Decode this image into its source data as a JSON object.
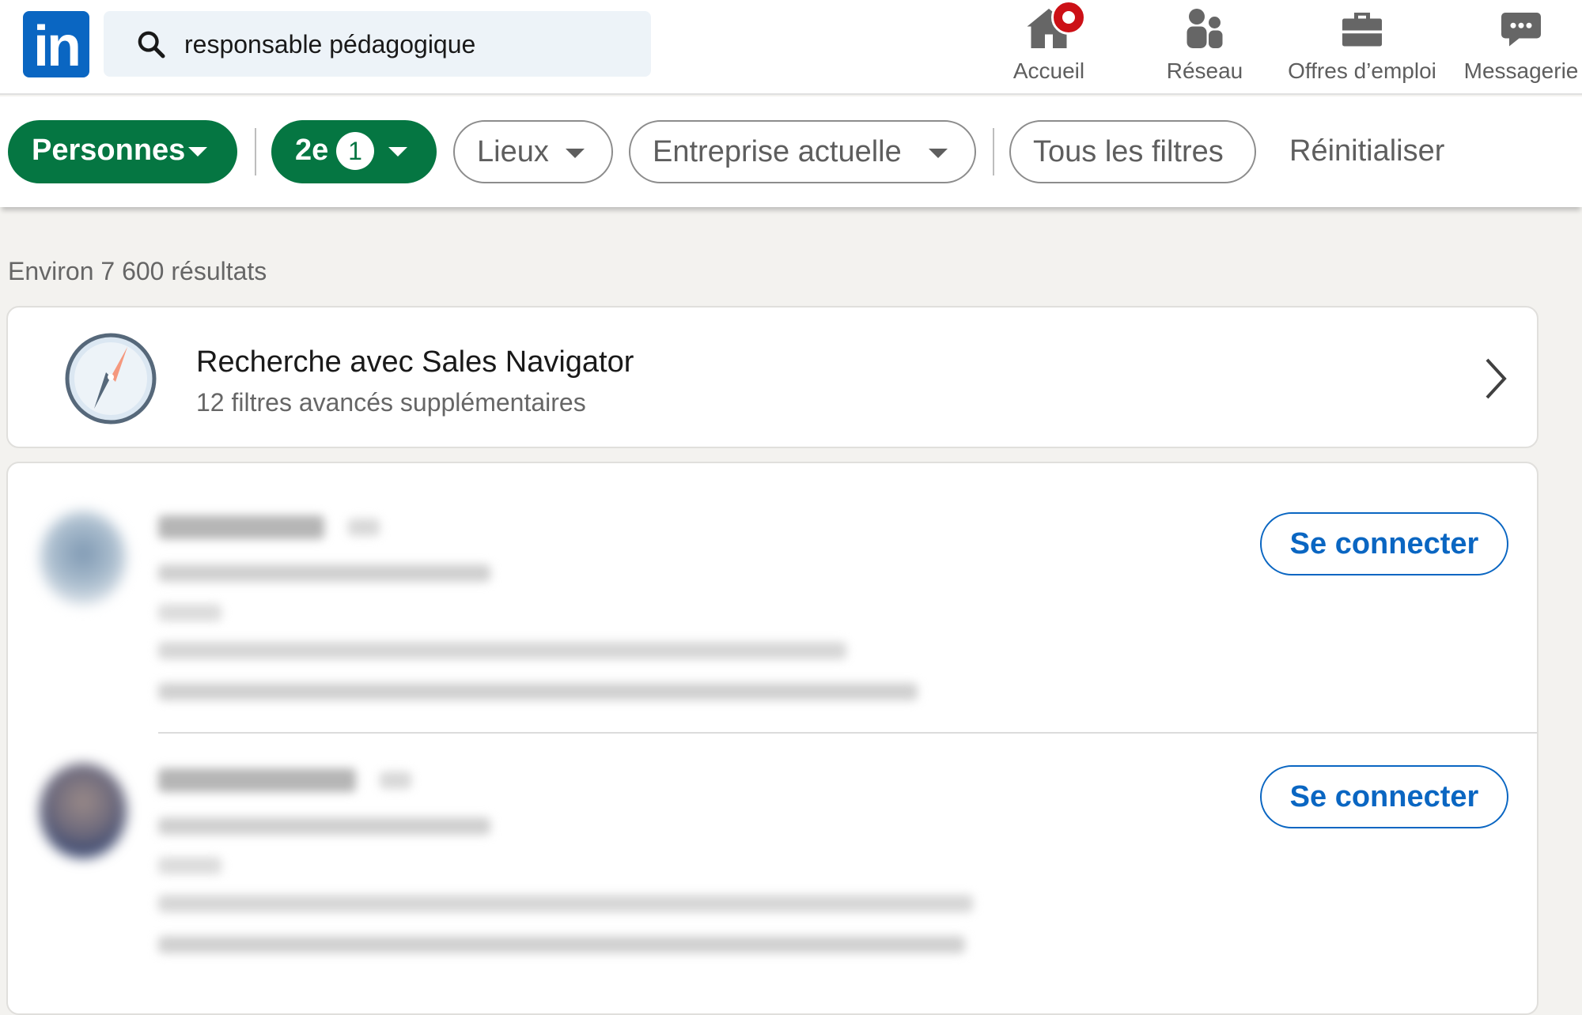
{
  "nav": {
    "logo": "in",
    "search_value": "responsable pédagogique",
    "items": [
      {
        "label": "Accueil",
        "icon": "home-icon"
      },
      {
        "label": "Réseau",
        "icon": "network-icon"
      },
      {
        "label": "Offres d’emploi",
        "icon": "briefcase-icon"
      },
      {
        "label": "Messagerie",
        "icon": "messaging-icon"
      }
    ]
  },
  "filters": {
    "people": "Personnes",
    "degree": "2e",
    "degree_count": "1",
    "places": "Lieux",
    "company": "Entreprise actuelle",
    "all": "Tous les filtres",
    "reset": "Réinitialiser"
  },
  "results": {
    "count": "Environ 7 600 résultats"
  },
  "sales_nav": {
    "title": "Recherche avec Sales Navigator",
    "subtitle": "12 filtres avancés supplémentaires"
  },
  "people": [
    {
      "connect_label": "Se connecter"
    },
    {
      "connect_label": "Se connecter"
    }
  ],
  "colors": {
    "brand": "#0a66c2",
    "active_filter": "#057642",
    "notification": "#cc1016"
  }
}
